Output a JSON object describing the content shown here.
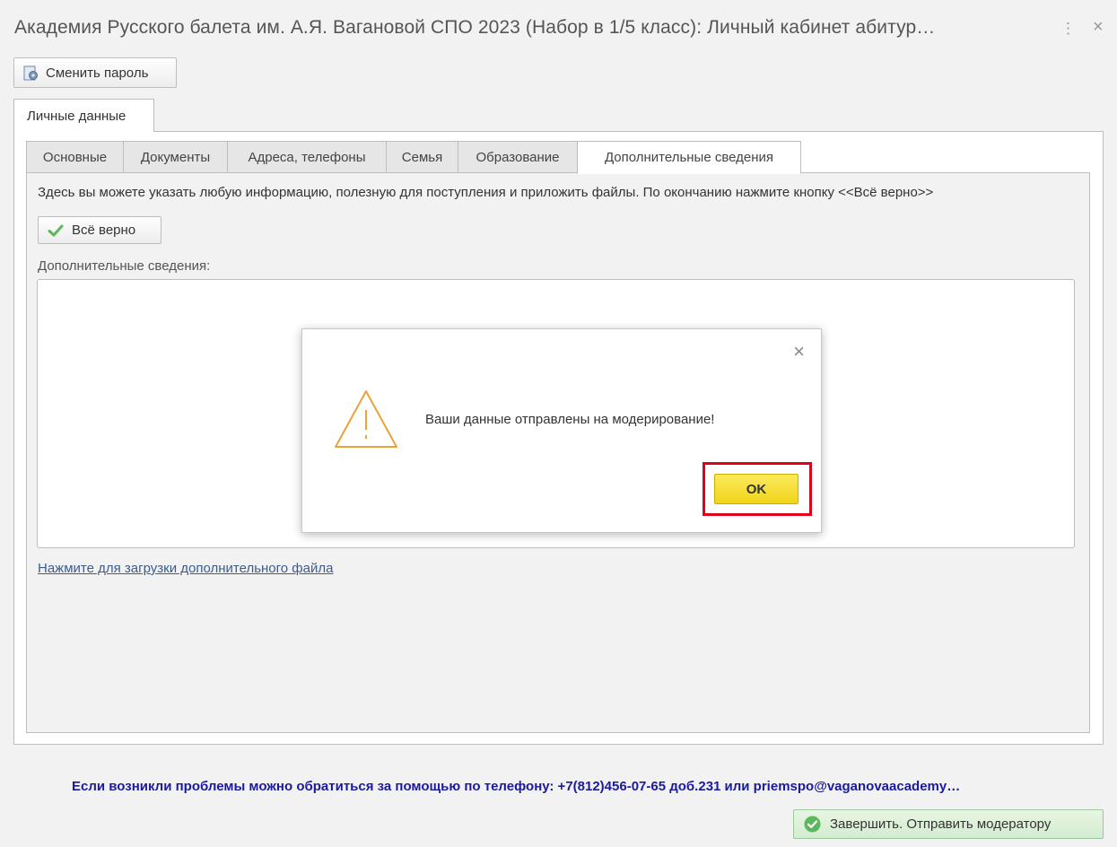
{
  "window": {
    "title": "Академия Русского балета им. А.Я. Вагановой СПО 2023 (Набор в 1/5 класс): Личный кабинет абитур…",
    "more_symbol": "⋮",
    "close_symbol": "×"
  },
  "toolbar": {
    "change_password_label": "Сменить пароль",
    "change_password_icon": "settings-doc-icon"
  },
  "outer_tabs": [
    {
      "label": "Личные данные",
      "active": true
    }
  ],
  "inner_tabs": [
    {
      "label": "Основные",
      "active": false
    },
    {
      "label": "Документы",
      "active": false
    },
    {
      "label": "Адреса, телефоны",
      "active": false
    },
    {
      "label": "Семья",
      "active": false
    },
    {
      "label": "Образование",
      "active": false
    },
    {
      "label": "Дополнительные сведения",
      "active": true
    }
  ],
  "content": {
    "info_text": "Здесь вы можете указать любую информацию, полезную для поступления и приложить файлы. По окончанию нажмите кнопку <<Всё верно>>",
    "all_right_label": "Всё верно",
    "field_label": "Дополнительные сведения:",
    "field_value": "",
    "upload_link": "Нажмите для загрузки дополнительного файла"
  },
  "dialog": {
    "icon": "warning-triangle-icon",
    "message": "Ваши данные отправлены на модерирование!",
    "ok_label": "OK",
    "close_symbol": "×",
    "highlight_color": "#e0001a"
  },
  "footer": {
    "help_text": "Если возникли проблемы можно обратиться за помощью по телефону:  +7(812)456-07-65 доб.231 или priemspo@vaganovaacademy…",
    "finish_label": "Завершить. Отправить модератору"
  },
  "colors": {
    "accent_yellow": "#f5dc2a",
    "link_blue": "#3b5c8f",
    "help_text": "#1a1aa0",
    "success_green": "#5cb85c",
    "warning_orange": "#e8a33a"
  }
}
